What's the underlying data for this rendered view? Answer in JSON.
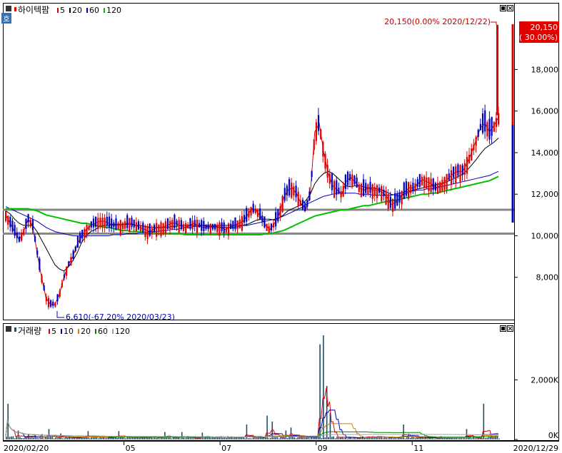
{
  "price_panel": {
    "title": "하이텍팜",
    "legend": [
      {
        "label": "5",
        "color": "#e00000"
      },
      {
        "label": "20",
        "color": "#000000"
      },
      {
        "label": "60",
        "color": "#0000c0"
      },
      {
        "label": "120",
        "color": "#00c000"
      }
    ],
    "badge": "호",
    "high_annotation": "20,150(0.00% 2020/12/22)",
    "low_annotation": "6,610(-67.20% 2020/03/23)",
    "current_price": "20,150",
    "current_change": "( 30.00%)",
    "yticks": [
      "8,000",
      "10,000",
      "12,000",
      "14,000",
      "16,000",
      "18,000"
    ]
  },
  "volume_panel": {
    "title": "거래량",
    "legend": [
      {
        "label": "5",
        "color": "#e00000"
      },
      {
        "label": "10",
        "color": "#0000c0"
      },
      {
        "label": "20",
        "color": "#d08000"
      },
      {
        "label": "60",
        "color": "#008000"
      },
      {
        "label": "120",
        "color": "#a0a0a0"
      }
    ],
    "yticks": [
      "0K",
      "2,000K"
    ]
  },
  "xaxis": {
    "start_label": "2020/02/20",
    "end_label": "2020/12/29",
    "ticks": [
      "05",
      "07",
      "09",
      "11"
    ]
  },
  "colors": {
    "up": "#e00000",
    "down": "#0000c0",
    "volume": "#1e4d6b",
    "support": "#888888"
  },
  "chart_data": [
    {
      "type": "candlestick",
      "title": "하이텍팜",
      "x_range": [
        "2020/02/20",
        "2020/12/29"
      ],
      "ylim": [
        6000,
        21000
      ],
      "yticks": [
        8000,
        10000,
        12000,
        14000,
        16000,
        18000
      ],
      "horizontal_lines": [
        11250,
        10100
      ],
      "series": [
        {
          "name": "5",
          "values": [
            11000,
            10600,
            10200,
            9800,
            10200,
            10800,
            10500,
            9200,
            8000,
            7000,
            6700,
            6700,
            7200,
            8000,
            8600,
            9000,
            9600,
            10000,
            10300,
            10500,
            10600,
            10700,
            10700,
            10600,
            10500,
            10500,
            10500,
            10600,
            10600,
            10500,
            10400,
            10300,
            10200,
            10300,
            10400,
            10400,
            10500,
            10600,
            10600,
            10500,
            10400,
            10500,
            10600,
            10500,
            10400,
            10400,
            10400,
            10400,
            10400,
            10300,
            10400,
            10500,
            10600,
            10700,
            11000,
            11300,
            11200,
            10900,
            10500,
            10300,
            10600,
            11000,
            11800,
            12200,
            12300,
            12000,
            11500,
            11300,
            12000,
            15000,
            15400,
            14000,
            13000,
            12400,
            12200,
            12000,
            12600,
            12800,
            12600,
            12300,
            12200,
            12300,
            12200,
            12200,
            12100,
            11900,
            11500,
            11600,
            11800,
            12100,
            12300,
            12300,
            12500,
            12700,
            12600,
            12500,
            12300,
            12400,
            12600,
            12800,
            13000,
            13100,
            13100,
            13500,
            14000,
            14600,
            15200,
            15400,
            15000,
            15300,
            15700
          ]
        },
        {
          "name": "20",
          "values": [
            11200,
            11050,
            10800,
            10600,
            10500,
            10500,
            10500,
            10200,
            9800,
            9400,
            9000,
            8600,
            8400,
            8300,
            8500,
            8800,
            9200,
            9700,
            10000,
            10200,
            10300,
            10450,
            10500,
            10500,
            10550,
            10550,
            10550,
            10550,
            10550,
            10500,
            10500,
            10450,
            10400,
            10400,
            10400,
            10400,
            10400,
            10450,
            10450,
            10500,
            10500,
            10500,
            10500,
            10500,
            10500,
            10450,
            10450,
            10450,
            10400,
            10400,
            10400,
            10400,
            10450,
            10500,
            10550,
            10650,
            10750,
            10800,
            10800,
            10800,
            10750,
            10850,
            11000,
            11200,
            11300,
            11400,
            11500,
            11700,
            12000,
            12500,
            12800,
            13000,
            13100,
            13000,
            12800,
            12600,
            12400,
            12350,
            12400,
            12400,
            12350,
            12300,
            12300,
            12250,
            12200,
            12100,
            12000,
            11950,
            11900,
            12000,
            12100,
            12200,
            12250,
            12300,
            12350,
            12400,
            12450,
            12500,
            12550,
            12650,
            12750,
            12850,
            12950,
            13150,
            13400,
            13650,
            13950,
            14200,
            14350,
            14500,
            14700
          ]
        },
        {
          "name": "60",
          "values": [
            11400,
            11300,
            11200,
            11100,
            11000,
            10900,
            10800,
            10700,
            10550,
            10400,
            10300,
            10200,
            10150,
            10100,
            10050,
            10000,
            10000,
            10000,
            10000,
            10000,
            10000,
            10000,
            10000,
            10000,
            10050,
            10050,
            10050,
            10100,
            10100,
            10100,
            10150,
            10150,
            10200,
            10200,
            10200,
            10250,
            10250,
            10300,
            10300,
            10350,
            10400,
            10400,
            10450,
            10450,
            10500,
            10500,
            10500,
            10500,
            10500,
            10500,
            10500,
            10500,
            10500,
            10500,
            10500,
            10550,
            10600,
            10650,
            10700,
            10750,
            10800,
            10850,
            10950,
            11050,
            11150,
            11250,
            11350,
            11500,
            11600,
            11700,
            11800,
            11900,
            11950,
            12000,
            12050,
            12050,
            12050,
            12050,
            12050,
            12000,
            12000,
            12000,
            11950,
            11950,
            11950,
            11950,
            11950,
            12000,
            12050,
            12100,
            12150,
            12150,
            12200,
            12200,
            12250,
            12250,
            12300,
            12350,
            12400,
            12450,
            12500,
            12550,
            12600,
            12650,
            12700,
            12750,
            12800,
            12850,
            12900,
            13000,
            13100
          ]
        },
        {
          "name": "120",
          "values": [
            11300,
            11300,
            11300,
            11300,
            11300,
            11300,
            11250,
            11200,
            11100,
            11000,
            10950,
            10900,
            10850,
            10800,
            10750,
            10700,
            10650,
            10600,
            10600,
            10550,
            10500,
            10450,
            10400,
            10400,
            10350,
            10300,
            10250,
            10250,
            10200,
            10200,
            10200,
            10150,
            10150,
            10150,
            10100,
            10100,
            10100,
            10100,
            10100,
            10100,
            10050,
            10050,
            10050,
            10050,
            10050,
            10050,
            10050,
            10050,
            10050,
            10050,
            10050,
            10050,
            10050,
            10050,
            10050,
            10050,
            10050,
            10050,
            10100,
            10100,
            10150,
            10200,
            10250,
            10350,
            10450,
            10550,
            10650,
            10750,
            10850,
            10950,
            11000,
            11050,
            11100,
            11150,
            11200,
            11250,
            11250,
            11300,
            11350,
            11400,
            11450,
            11450,
            11500,
            11550,
            11600,
            11650,
            11700,
            11700,
            11750,
            11800,
            11850,
            11900,
            11950,
            12000,
            12000,
            12050,
            12050,
            12100,
            12150,
            12200,
            12250,
            12300,
            12350,
            12400,
            12450,
            12500,
            12550,
            12600,
            12650,
            12750,
            12850
          ]
        }
      ]
    },
    {
      "type": "bar",
      "title": "거래량",
      "x_range": [
        "2020/02/20",
        "2020/12/29"
      ],
      "ylim": [
        0,
        3500
      ],
      "yticks": [
        0,
        2000
      ],
      "bars_per_panel": 176,
      "spikes": [
        {
          "index": 1,
          "value": 1200
        },
        {
          "index": 7,
          "value": 300
        },
        {
          "index": 13,
          "value": 180
        },
        {
          "index": 17,
          "value": 150
        },
        {
          "index": 21,
          "value": 180
        },
        {
          "index": 25,
          "value": 350
        },
        {
          "index": 32,
          "value": 200
        },
        {
          "index": 48,
          "value": 280
        },
        {
          "index": 66,
          "value": 280
        },
        {
          "index": 93,
          "value": 250
        },
        {
          "index": 103,
          "value": 250
        },
        {
          "index": 115,
          "value": 230
        },
        {
          "index": 141,
          "value": 500
        },
        {
          "index": 153,
          "value": 800
        },
        {
          "index": 156,
          "value": 600
        },
        {
          "index": 164,
          "value": 300
        },
        {
          "index": 167,
          "value": 400
        },
        {
          "index": 184,
          "value": 3200
        },
        {
          "index": 186,
          "value": 3500
        },
        {
          "index": 188,
          "value": 1800
        },
        {
          "index": 190,
          "value": 900
        },
        {
          "index": 233,
          "value": 500
        },
        {
          "index": 236,
          "value": 200
        },
        {
          "index": 270,
          "value": 350
        },
        {
          "index": 280,
          "value": 1200
        }
      ]
    }
  ]
}
